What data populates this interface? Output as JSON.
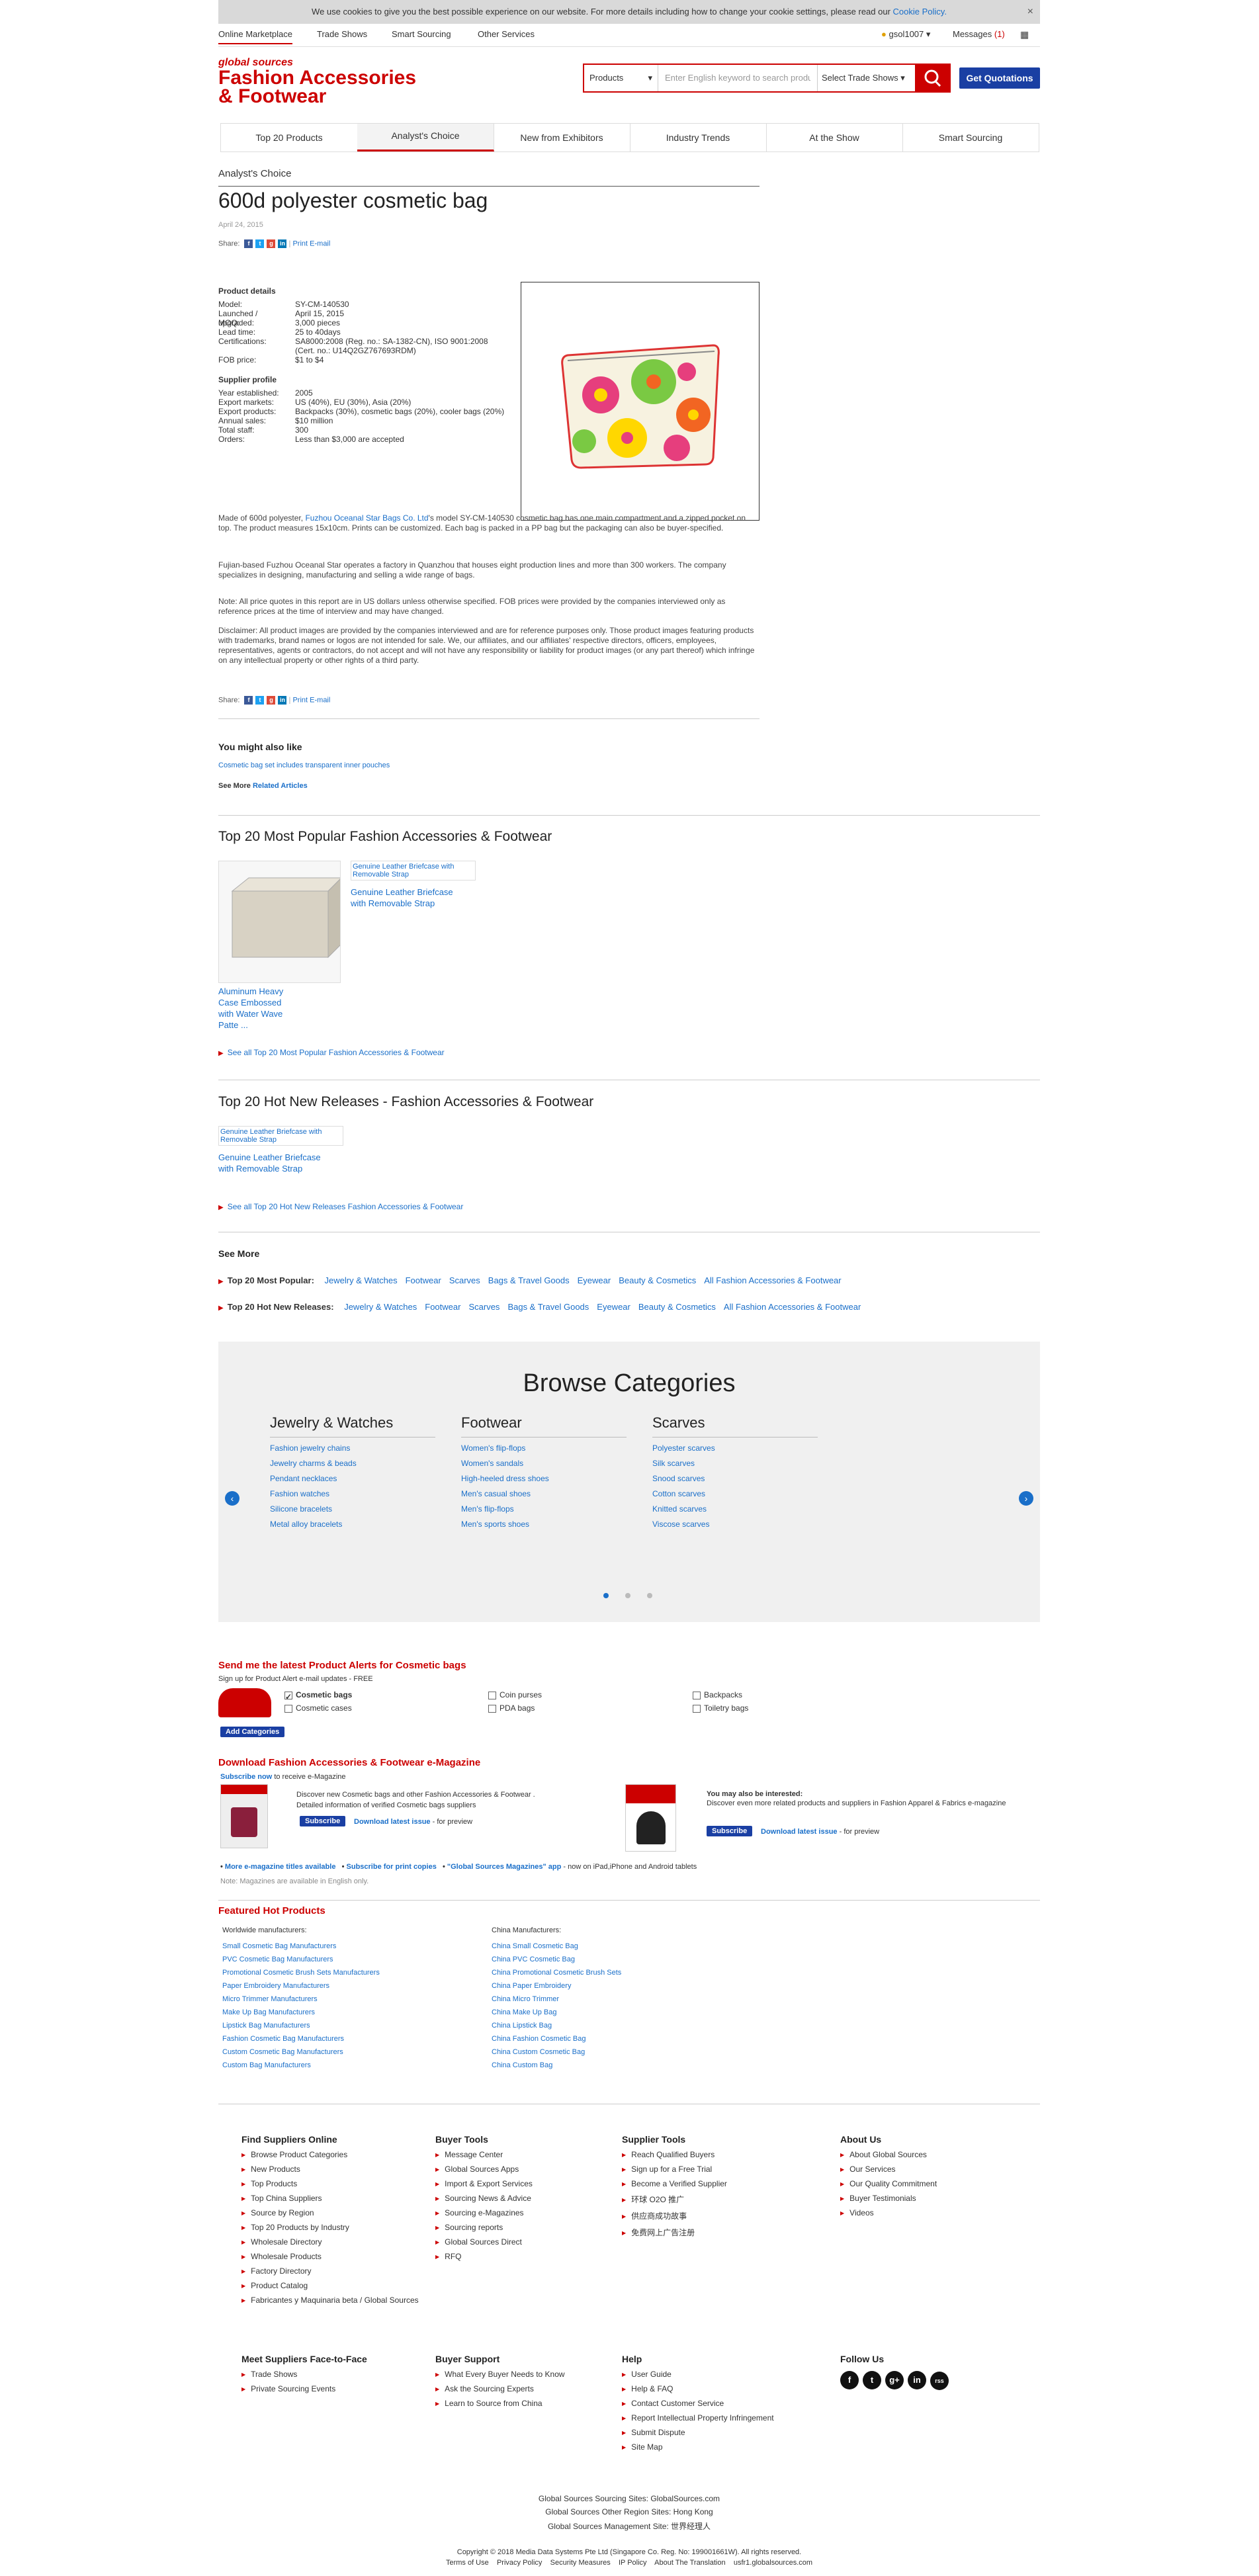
{
  "cookie": {
    "text": "We use cookies to give you the best possible experience on our website. For more details including how to change your cookie settings, please read our",
    "link": "Cookie Policy.",
    "close": "×"
  },
  "topnav": {
    "items": [
      "Online Marketplace",
      "Trade Shows",
      "Smart Sourcing",
      "Other Services"
    ],
    "user": "gsol1007",
    "messages": "Messages",
    "messages_count": "(1)"
  },
  "header": {
    "logo_small": "global sources",
    "logo_line1": "Fashion Accessories",
    "logo_line2": "& Footwear",
    "search_type": "Products",
    "search_placeholder": "Enter English keyword to search products",
    "trade_shows": "Select Trade Shows",
    "get_quotations": "Get Quotations"
  },
  "tabs": [
    "Top 20 Products",
    "Analyst's Choice",
    "New from Exhibitors",
    "Industry Trends",
    "At the Show",
    "Smart Sourcing"
  ],
  "article": {
    "kicker": "Analyst's Choice",
    "title": "600d polyester cosmetic bag",
    "date": "April 24, 2015",
    "share_label": "Share:",
    "print": "Print",
    "email": "E-mail",
    "product_details_title": "Product details",
    "product_details": [
      {
        "k": "Model:",
        "v": "SY-CM-140530"
      },
      {
        "k": "Launched / upgraded:",
        "v": "April 15, 2015"
      },
      {
        "k": "MOQ:",
        "v": "3,000 pieces"
      },
      {
        "k": "Lead time:",
        "v": "25 to 40days"
      },
      {
        "k": "Certifications:",
        "v": "SA8000:2008 (Reg. no.: SA-1382-CN), ISO 9001:2008 (Cert. no.: U14Q2GZ767693RDM)"
      },
      {
        "k": "FOB price:",
        "v": "$1 to $4"
      }
    ],
    "supplier_profile_title": "Supplier profile",
    "supplier_profile": [
      {
        "k": "Year established:",
        "v": "2005"
      },
      {
        "k": "Export markets:",
        "v": "US (40%), EU (30%), Asia (20%)"
      },
      {
        "k": "Export products:",
        "v": "Backpacks (30%), cosmetic bags (20%), cooler bags (20%)"
      },
      {
        "k": "Annual sales:",
        "v": "$10 million"
      },
      {
        "k": "Total staff:",
        "v": "300"
      },
      {
        "k": "Orders:",
        "v": "Less than $3,000 are accepted"
      }
    ],
    "p1_a": "Made of 600d polyester,",
    "p1_link": "Fuzhou Oceanal Star Bags Co. Ltd",
    "p1_b": "'s model SY-CM-140530 cosmetic bag has one main compartment and a zipped pocket on top. The product measures 15x10cm. Prints can be customized. Each bag is packed in a PP bag but the packaging can also be buyer-specified.",
    "p2": "Fujian-based Fuzhou Oceanal Star operates a factory in Quanzhou that houses eight production lines and more than 300 workers. The company specializes in designing, manufacturing and selling a wide range of bags.",
    "p3": "Note: All price quotes in this report are in US dollars unless otherwise specified. FOB prices were provided by the companies interviewed only as reference prices at the time of interview and may have changed.",
    "p4": "Disclaimer: All product images are provided by the companies interviewed and are for reference purposes only. Those product images featuring products with trademarks, brand names or logos are not intended for sale. We, our affiliates, and our affiliates' respective directors, officers, employees, representatives, agents or contractors, do not accept and will not have any responsibility or liability for product images (or any part thereof) which infringe on any intellectual property or other rights of a third party."
  },
  "also_like": {
    "title": "You might also like",
    "link": "Cosmetic bag set includes transparent inner pouches",
    "see_more": "See More",
    "related": "Related Articles"
  },
  "top20popular": {
    "title": "Top 20 Most Popular Fashion Accessories & Footwear",
    "item1": "Aluminum Heavy Case Embossed with Water Wave Patte ...",
    "item2_alt": "Genuine Leather Briefcase with Removable Strap",
    "item2": "Genuine Leather Briefcase with Removable Strap",
    "see_all": "See all Top 20 Most Popular Fashion Accessories & Footwear"
  },
  "top20new": {
    "title": "Top 20 Hot New Releases - Fashion Accessories & Footwear",
    "item_alt": "Genuine Leather Briefcase with Removable Strap",
    "item": "Genuine Leather Briefcase with Removable Strap",
    "see_all": "See all Top 20 Hot New Releases Fashion Accessories & Footwear"
  },
  "see_more": {
    "title": "See More",
    "popular_label": "Top 20 Most Popular:",
    "new_label": "Top 20 Hot New Releases:",
    "links": [
      "Jewelry & Watches",
      "Footwear",
      "Scarves",
      "Bags & Travel Goods",
      "Eyewear",
      "Beauty & Cosmetics",
      "All Fashion Accessories & Footwear"
    ]
  },
  "browse": {
    "title": "Browse Categories",
    "columns": [
      {
        "head": "Jewelry & Watches",
        "links": [
          "Fashion jewelry chains",
          "Jewelry charms & beads",
          "Pendant necklaces",
          "Fashion watches",
          "Silicone bracelets",
          "Metal alloy bracelets"
        ]
      },
      {
        "head": "Footwear",
        "links": [
          "Women's flip-flops",
          "Women's sandals",
          "High-heeled dress shoes",
          "Men's casual shoes",
          "Men's flip-flops",
          "Men's sports shoes"
        ]
      },
      {
        "head": "Scarves",
        "links": [
          "Polyester scarves",
          "Silk scarves",
          "Snood scarves",
          "Cotton scarves",
          "Knitted scarves",
          "Viscose scarves"
        ]
      }
    ]
  },
  "alerts": {
    "title": "Send me the latest Product Alerts for Cosmetic bags",
    "sub": "Sign up for Product Alert e-mail updates - FREE",
    "options": [
      "Cosmetic bags",
      "Cosmetic cases",
      "Coin purses",
      "PDA bags",
      "Backpacks",
      "Toiletry bags"
    ],
    "add": "Add Categories"
  },
  "emag": {
    "title_a": "Download",
    "title_b": "Fashion Accessories & Footwear",
    "title_c": "e-Magazine",
    "sub_link": "Subscribe now",
    "sub_rest": "to receive e-Magazine",
    "b1": "Discover new Cosmetic bags and other Fashion Accessories & Footwear .",
    "b2": "Detailed information of verified Cosmetic bags suppliers",
    "subscribe": "Subscribe",
    "download": "Download latest issue",
    "preview": "- for preview",
    "also_title": "You may also be interested:",
    "also_text": "Discover even more related products and suppliers in Fashion Apparel & Fabrics e-magazine",
    "more1": "More e-magazine titles available",
    "more2": "Subscribe for print copies",
    "more3": "\"Global Sources Magazines\" app",
    "more3_rest": "- now on iPad,iPhone and Android tablets",
    "note": "Note: Magazines are available in English only."
  },
  "featured": {
    "title": "Featured Hot Products",
    "world_label": "Worldwide manufacturers:",
    "china_label": "China Manufacturers:",
    "world": [
      "Small Cosmetic Bag Manufacturers",
      "PVC Cosmetic Bag Manufacturers",
      "Promotional Cosmetic Brush Sets Manufacturers",
      "Paper Embroidery Manufacturers",
      "Micro Trimmer Manufacturers",
      "Make Up Bag Manufacturers",
      "Lipstick Bag Manufacturers",
      "Fashion Cosmetic Bag Manufacturers",
      "Custom Cosmetic Bag Manufacturers",
      "Custom Bag Manufacturers"
    ],
    "china": [
      "China Small Cosmetic Bag",
      "China PVC Cosmetic Bag",
      "China Promotional Cosmetic Brush Sets",
      "China Paper Embroidery",
      "China Micro Trimmer",
      "China Make Up Bag",
      "China Lipstick Bag",
      "China Fashion Cosmetic Bag",
      "China Custom Cosmetic Bag",
      "China Custom Bag"
    ]
  },
  "footer": {
    "find": {
      "title": "Find Suppliers Online",
      "links": [
        "Browse Product Categories",
        "New Products",
        "Top Products",
        "Top China Suppliers",
        "Source by Region",
        "Top 20 Products by Industry",
        "Wholesale Directory",
        "Wholesale Products",
        "Factory Directory",
        "Product Catalog",
        "Fabricantes y Maquinaria beta / Global Sources"
      ]
    },
    "buyer": {
      "title": "Buyer Tools",
      "links": [
        "Message Center",
        "Global Sources Apps",
        "Import & Export Services",
        "Sourcing News & Advice",
        "Sourcing e-Magazines",
        "Sourcing reports",
        "Global Sources Direct",
        "RFQ"
      ]
    },
    "supplier": {
      "title": "Supplier Tools",
      "links": [
        "Reach Qualified Buyers",
        "Sign up for a Free Trial",
        "Become a Verified Supplier",
        "环球 O2O 推广",
        "供应商成功故事",
        "免费网上广告注册"
      ]
    },
    "about": {
      "title": "About Us",
      "links": [
        "About Global Sources",
        "Our Services",
        "Our Quality Commitment",
        "Buyer Testimonials",
        "Videos"
      ]
    },
    "meet": {
      "title": "Meet Suppliers Face-to-Face",
      "links": [
        "Trade Shows",
        "Private Sourcing Events"
      ]
    },
    "support": {
      "title": "Buyer Support",
      "links": [
        "What Every Buyer Needs to Know",
        "Ask the Sourcing Experts",
        "Learn to Source from China"
      ]
    },
    "help": {
      "title": "Help",
      "links": [
        "User Guide",
        "Help & FAQ",
        "Contact Customer Service",
        "Report Intellectual Property Infringement",
        "Submit Dispute",
        "Site Map"
      ]
    },
    "follow": {
      "title": "Follow Us",
      "icons": [
        "f",
        "t",
        "g+",
        "in",
        "rss"
      ]
    },
    "sites1": "Global Sources Sourcing Sites: GlobalSources.com",
    "sites2": "Global Sources Other Region Sites: Hong Kong",
    "sites3": "Global Sources Management Site: 世界经理人",
    "copyright": "Copyright © 2018 Media Data Systems Pte Ltd (Singapore Co. Reg. No: 199001661W). All rights reserved.",
    "legal": "Terms of Use    Privacy Policy    Security Measures    IP Policy    About The Translation    usfr1.globalsources.com"
  }
}
